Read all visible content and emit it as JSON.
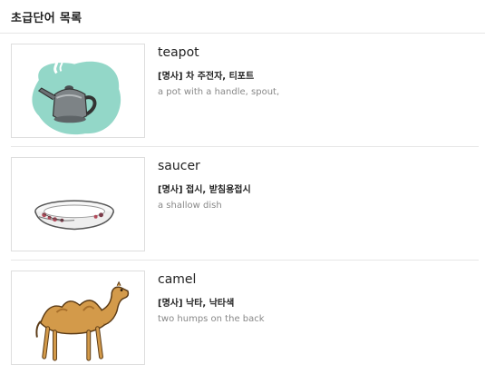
{
  "header": {
    "title": "초급단어 목록"
  },
  "items": [
    {
      "word": "teapot",
      "meaning": "[명사] 차 주전자, 티포트",
      "description": "a pot with a handle, spout,",
      "image": "teapot-illustration"
    },
    {
      "word": "saucer",
      "meaning": "[명사] 접시, 받침용접시",
      "description": "a shallow dish",
      "image": "saucer-illustration"
    },
    {
      "word": "camel",
      "meaning": "[명사] 낙타, 낙타색",
      "description": "two humps on the back",
      "image": "camel-illustration"
    }
  ]
}
